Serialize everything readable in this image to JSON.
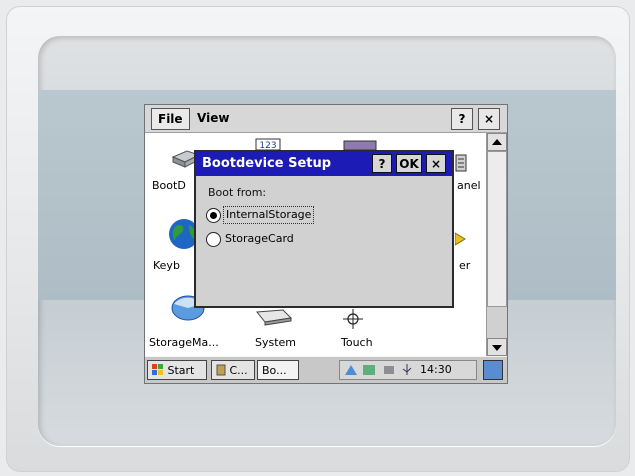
{
  "menubar": {
    "file": "File",
    "view": "View",
    "help_button": "?",
    "close_button": "×"
  },
  "desktop": {
    "icons": [
      {
        "id": "bootdevice",
        "label": "BootD"
      },
      {
        "id": "panel",
        "label": "anel"
      },
      {
        "id": "keyboard",
        "label": "Keyb"
      },
      {
        "id": "power",
        "label": "er"
      },
      {
        "id": "storage",
        "label": "StorageMa..."
      },
      {
        "id": "system",
        "label": "System"
      },
      {
        "id": "touch",
        "label": "Touch"
      },
      {
        "id": "dateicon",
        "label": "123"
      }
    ]
  },
  "dialog": {
    "title": "Bootdevice Setup",
    "help_button": "?",
    "ok_button": "OK",
    "close_button": "×",
    "boot_from_label": "Boot from:",
    "options": [
      {
        "label": "InternalStorage",
        "selected": true
      },
      {
        "label": "StorageCard",
        "selected": false
      }
    ]
  },
  "taskbar": {
    "start_label": "Start",
    "task1_label": "C...",
    "task2_label": "Bo...",
    "clock": "14:30"
  },
  "colors": {
    "title_bar": "#1d1bb5",
    "dialog_bg": "#d1d1d1",
    "taskbar_bg": "#c8c8c8"
  }
}
